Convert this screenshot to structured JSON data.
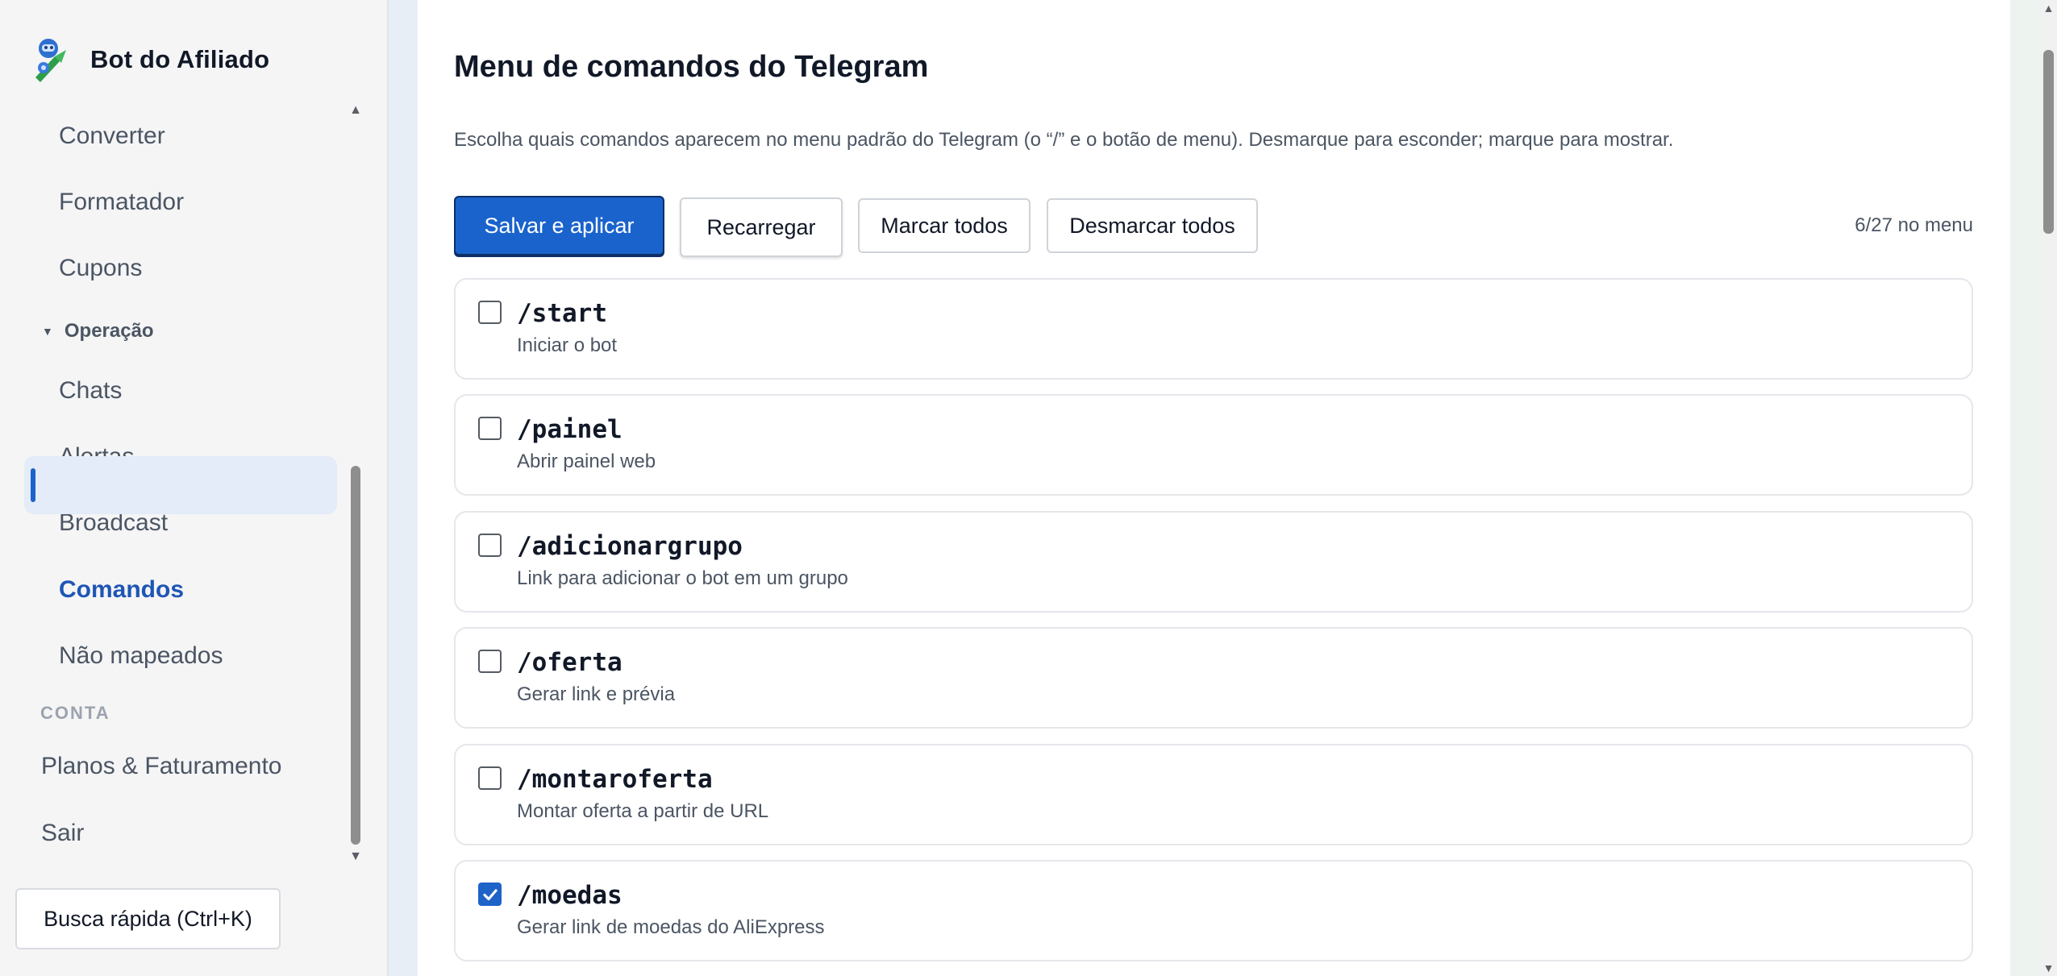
{
  "app": {
    "title": "Bot do Afiliado"
  },
  "sidebar": {
    "items": [
      {
        "label": "Converter"
      },
      {
        "label": "Formatador"
      },
      {
        "label": "Cupons"
      },
      {
        "label": "Operação"
      },
      {
        "label": "Chats"
      },
      {
        "label": "Alertas"
      },
      {
        "label": "Broadcast"
      },
      {
        "label": "Comandos"
      },
      {
        "label": "Não mapeados"
      },
      {
        "label": "CONTA"
      },
      {
        "label": "Planos & Faturamento"
      },
      {
        "label": "Sair"
      }
    ],
    "active_item": "Comandos",
    "quick_search": "Busca rápida (Ctrl+K)"
  },
  "main": {
    "title": "Menu de comandos do Telegram",
    "description": "Escolha quais comandos aparecem no menu padrão do Telegram (o “/” e o botão de menu). Desmarque para esconder; marque para mostrar.",
    "buttons": {
      "save": "Salvar e aplicar",
      "reload": "Recarregar",
      "mark_all": "Marcar todos",
      "unmark_all": "Desmarcar todos"
    },
    "count": "6/27 no menu",
    "commands": [
      {
        "name": "/start",
        "description": "Iniciar o bot",
        "checked": false
      },
      {
        "name": "/painel",
        "description": "Abrir painel web",
        "checked": false
      },
      {
        "name": "/adicionargrupo",
        "description": "Link para adicionar o bot em um grupo",
        "checked": false
      },
      {
        "name": "/oferta",
        "description": "Gerar link e prévia",
        "checked": false
      },
      {
        "name": "/montaroferta",
        "description": "Montar oferta a partir de URL",
        "checked": false
      },
      {
        "name": "/moedas",
        "description": "Gerar link de moedas do AliExpress",
        "checked": true
      }
    ]
  },
  "colors": {
    "accent": "#1a63cc",
    "active_bg": "#e3ecf8",
    "active_text": "#1e56b4"
  },
  "icons": {
    "brand": "robot-rocket-logo",
    "group_caret": "caret-down-icon",
    "checkbox_checked": "check-icon"
  }
}
